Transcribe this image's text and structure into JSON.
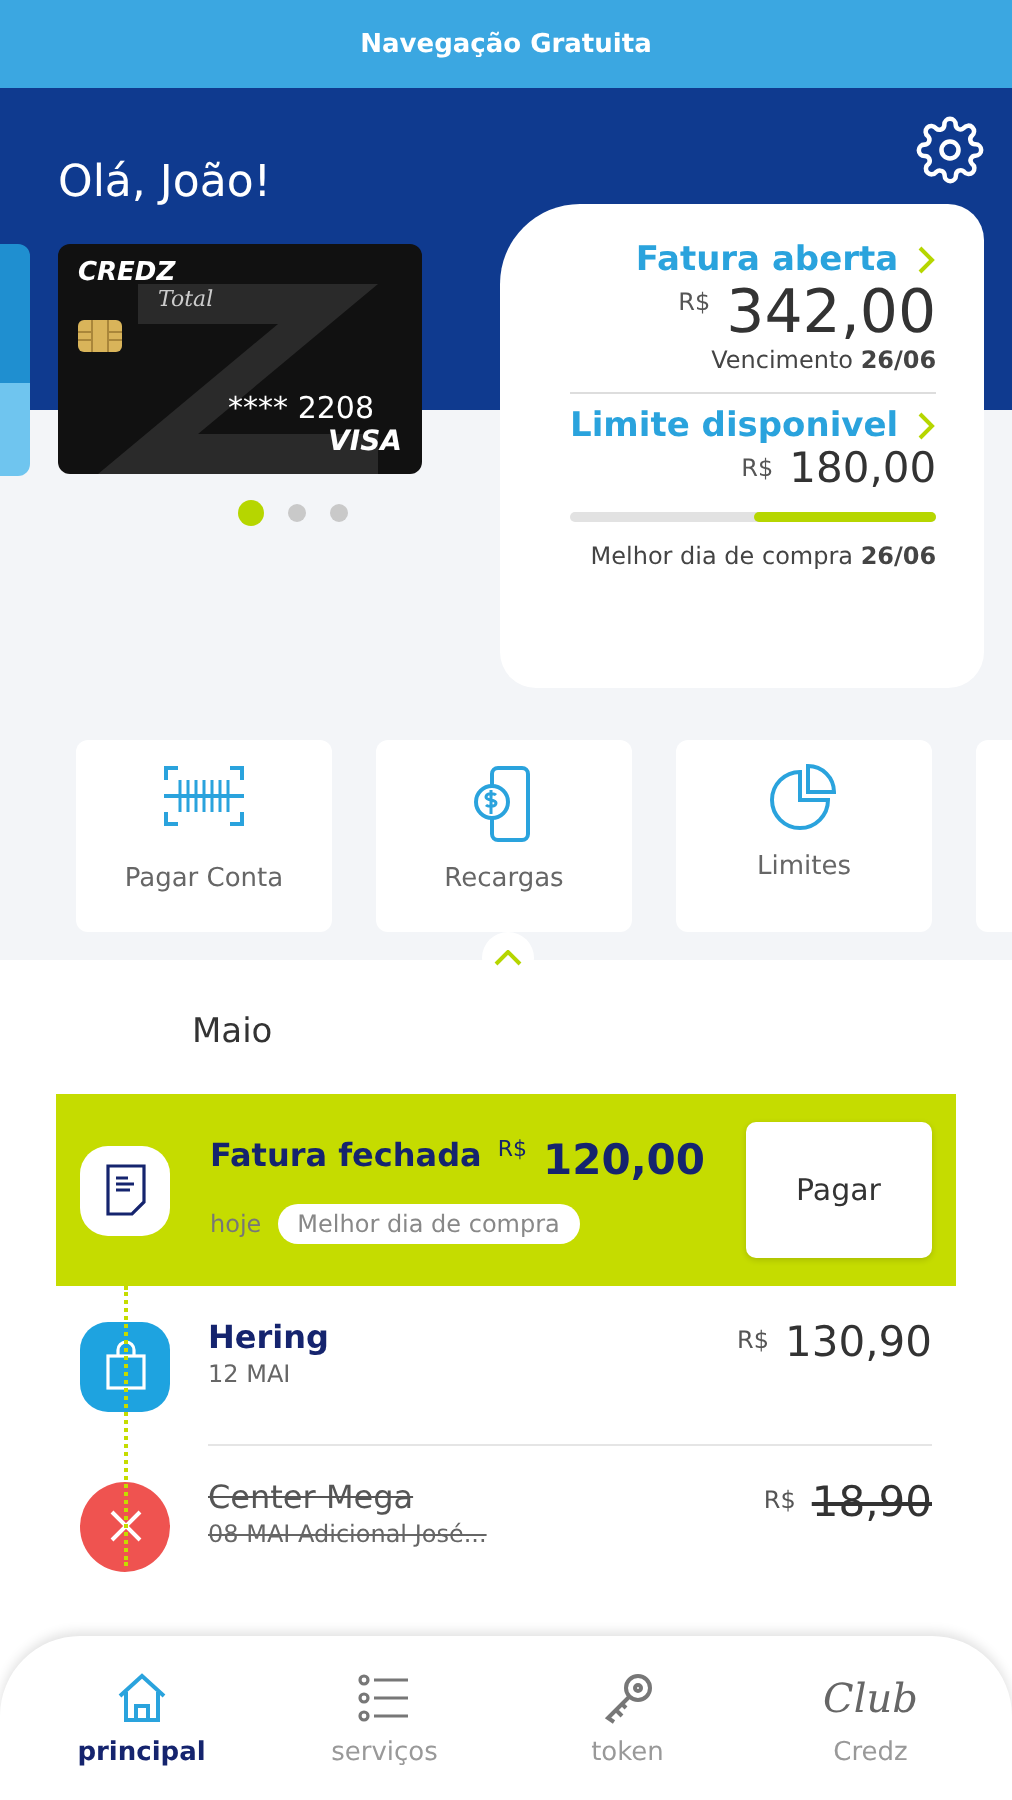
{
  "top_bar": {
    "title": "Navegação Gratuita"
  },
  "greeting": "Olá, João!",
  "card": {
    "brand": "CREDZ",
    "product": "Total",
    "number": "**** 2208",
    "network": "VISA"
  },
  "carousel": [
    {
      "selected": true
    },
    {
      "selected": false
    },
    {
      "selected": false
    }
  ],
  "invoice": {
    "title": "Fatura aberta",
    "currency": "R$",
    "amount": "342,00",
    "due": "Vencimento **26/06**"
  },
  "limit": {
    "title": "Limite disponivel",
    "currency": "R$",
    "amount": "180,00",
    "level": 0.5,
    "best_day": "Melhor dia de compra **26/06**"
  },
  "actions": [
    {
      "kind": "barcode",
      "label": "Pagar Conta"
    },
    {
      "kind": "recharge",
      "label": "Recargas"
    },
    {
      "kind": "chart",
      "label": "Limites"
    },
    {
      "kind": "blank"
    }
  ],
  "month": "Maio",
  "timeline": [
    {
      "kind": "closed_invoice",
      "title": "Fatura fechada",
      "currency": "R$",
      "amount": "120,00",
      "date": "hoje",
      "tag": "Melhor dia de compra",
      "button": "Pagar"
    },
    {
      "kind": "purchase",
      "title": "Hering",
      "date": "12 MAI",
      "currency": "R$",
      "amount": "130,90",
      "cancelled": false
    },
    {
      "kind": "cancelled",
      "title": "Center Mega",
      "date": "08 MAI Adicional José...",
      "currency": "R$",
      "amount": "18,90",
      "cancelled": true
    }
  ],
  "nav": [
    {
      "kind": "home",
      "label": "principal",
      "selected": true
    },
    {
      "kind": "list",
      "label": "serviços",
      "selected": false
    },
    {
      "kind": "key",
      "label": "token",
      "selected": false
    },
    {
      "kind": "club",
      "logo": "Club",
      "label": "Credz",
      "selected": false
    }
  ]
}
